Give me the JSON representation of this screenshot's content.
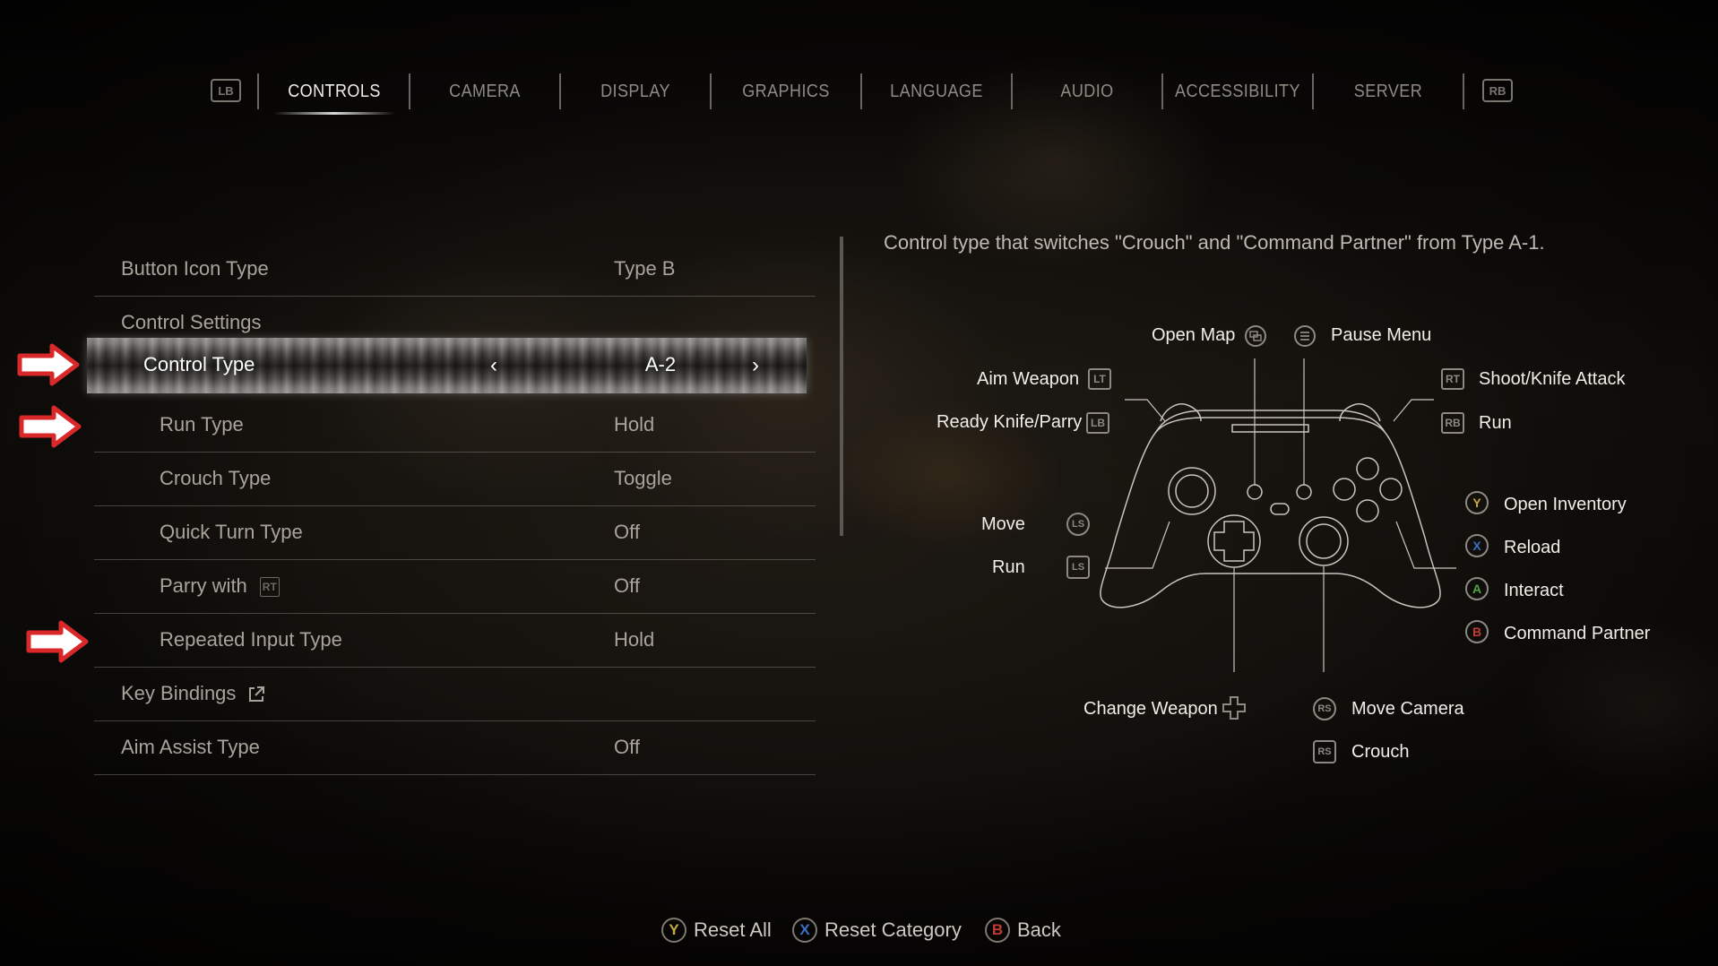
{
  "tabs": {
    "left_shoulder": "LB",
    "right_shoulder": "RB",
    "items": [
      {
        "label": "CONTROLS",
        "active": true
      },
      {
        "label": "CAMERA",
        "active": false
      },
      {
        "label": "DISPLAY",
        "active": false
      },
      {
        "label": "GRAPHICS",
        "active": false
      },
      {
        "label": "LANGUAGE",
        "active": false
      },
      {
        "label": "AUDIO",
        "active": false
      },
      {
        "label": "ACCESSIBILITY",
        "active": false
      },
      {
        "label": "SERVER",
        "active": false
      }
    ]
  },
  "settings": {
    "button_icon_type": {
      "label": "Button Icon Type",
      "value": "Type B"
    },
    "control_settings": {
      "label": "Control Settings"
    },
    "control_type": {
      "label": "Control Type",
      "value": "A-2"
    },
    "run_type": {
      "label": "Run Type",
      "value": "Hold"
    },
    "crouch_type": {
      "label": "Crouch Type",
      "value": "Toggle"
    },
    "quick_turn_type": {
      "label": "Quick Turn Type",
      "value": "Off"
    },
    "parry_with": {
      "label": "Parry with",
      "button": "RT",
      "value": "Off"
    },
    "repeated_input_type": {
      "label": "Repeated Input Type",
      "value": "Hold"
    },
    "key_bindings": {
      "label": "Key Bindings"
    },
    "aim_assist_type": {
      "label": "Aim Assist Type",
      "value": "Off"
    }
  },
  "description": "Control type that switches \"Crouch\" and \"Command Partner\" from Type A-1.",
  "controller": {
    "open_map": "Open Map",
    "pause_menu": "Pause Menu",
    "aim_weapon": "Aim Weapon",
    "aim_weapon_btn": "LT",
    "ready_knife": "Ready Knife/Parry",
    "ready_knife_btn": "LB",
    "shoot": "Shoot/Knife Attack",
    "shoot_btn": "RT",
    "run_rb": "Run",
    "run_rb_btn": "RB",
    "move": "Move",
    "move_btn": "LS",
    "run_ls": "Run",
    "run_ls_btn": "LS",
    "open_inventory": "Open Inventory",
    "reload": "Reload",
    "interact": "Interact",
    "command_partner": "Command Partner",
    "change_weapon": "Change Weapon",
    "move_camera": "Move Camera",
    "move_camera_btn": "RS",
    "crouch": "Crouch",
    "crouch_btn": "RS",
    "face_buttons": {
      "y": "Y",
      "x": "X",
      "a": "A",
      "b": "B"
    },
    "colors": {
      "y": "#c8a93a",
      "x": "#3b6fc4",
      "a": "#4ea646",
      "b": "#c23a32"
    }
  },
  "bottom_bar": {
    "reset_all_btn": "Y",
    "reset_all": "Reset All",
    "reset_category_btn": "X",
    "reset_category": "Reset Category",
    "back_btn": "B",
    "back": "Back"
  },
  "annotation_color": "#d8282a"
}
